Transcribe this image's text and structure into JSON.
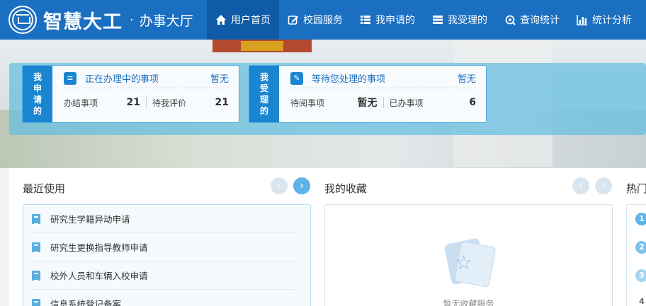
{
  "header": {
    "brand": "智慧大工",
    "separator": "·",
    "subtitle": "办事大厅",
    "nav": [
      {
        "label": "用户首页",
        "icon": "home-icon",
        "active": true
      },
      {
        "label": "校园服务",
        "icon": "edit-icon",
        "active": false
      },
      {
        "label": "我申请的",
        "icon": "list-icon",
        "active": false
      },
      {
        "label": "我受理的",
        "icon": "inbox-icon",
        "active": false
      },
      {
        "label": "查询统计",
        "icon": "search-settings-icon",
        "active": false
      },
      {
        "label": "统计分析",
        "icon": "bar-chart-icon",
        "active": false
      }
    ]
  },
  "cards": {
    "applied": {
      "tab": [
        "我",
        "申",
        "请",
        "的"
      ],
      "title": "正在办理中的事项",
      "status": "暂无",
      "stat1_label": "办结事项",
      "stat1_value": "21",
      "stat2_label": "待我评价",
      "stat2_value": "21"
    },
    "handled": {
      "tab": [
        "我",
        "受",
        "理",
        "的"
      ],
      "title": "等待您处理的事项",
      "status": "暂无",
      "stat1_label": "待阅事项",
      "stat1_value": "暂无",
      "stat2_label": "已办事项",
      "stat2_value": "6"
    }
  },
  "recent": {
    "title": "最近使用",
    "items": [
      "研究生学籍异动申请",
      "研究生更换指导教师申请",
      "校外人员和车辆入校申请",
      "信息系统登记备案"
    ]
  },
  "favorites": {
    "title": "我的收藏",
    "empty_text": "暂无收藏服务"
  },
  "hot": {
    "title": "热门",
    "numbers": [
      "1",
      "2",
      "3",
      "4"
    ]
  },
  "colors": {
    "header_bg": "#1a6fc1",
    "nav_active_bg": "#0f5ba7",
    "accent": "#1a86d0"
  }
}
